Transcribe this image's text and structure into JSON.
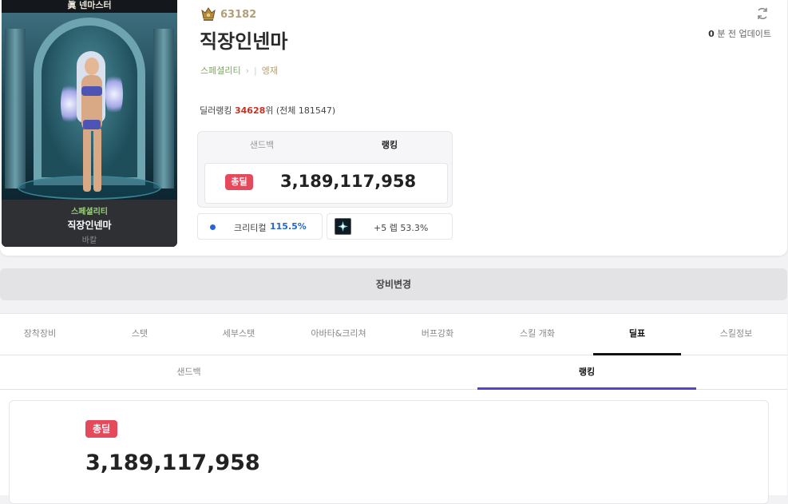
{
  "character": {
    "job_banner": "眞 넨마스터",
    "fame": "63182",
    "name": "직장인넨마",
    "type": "스페셜리티",
    "guild": "엥재",
    "server": "바칼",
    "updated_num": "0",
    "updated_text": "분 전 업데이트"
  },
  "ranking": {
    "prefix": "딜러랭킹",
    "rank": "34628",
    "suffix": "위 (전체 181547)"
  },
  "damage_box": {
    "tabs": [
      "샌드백",
      "랭킹"
    ],
    "badge": "총딜",
    "value": "3,189,117,958"
  },
  "stats": {
    "crit_label": "크리티컬",
    "crit_value": "115.5%",
    "skill_text": "+5 렙 53.3%"
  },
  "equip_bar": {
    "label": "장비변경"
  },
  "main_tabs": [
    "장착장비",
    "스탯",
    "세부스탯",
    "아바타&크리쳐",
    "버프강화",
    "스킬 개화",
    "딜표",
    "스킬정보"
  ],
  "sub_tabs": [
    "샌드백",
    "랭킹"
  ],
  "result": {
    "badge": "총딜",
    "value": "3,189,117,958"
  },
  "colors": {
    "accent_red": "#e5495c",
    "rank_red": "#c9301e",
    "crit_blue": "#2766d0",
    "active_tab_purple": "#5b3fd0"
  }
}
